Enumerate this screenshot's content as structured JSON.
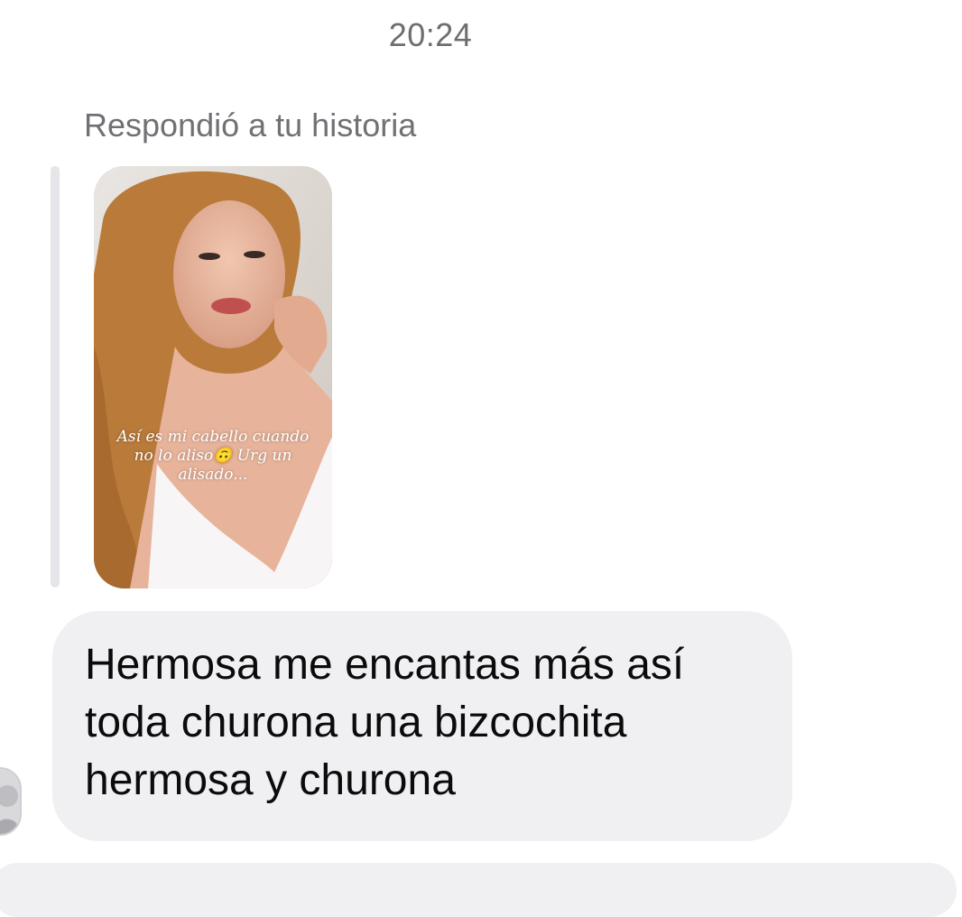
{
  "conversation": {
    "timestamp": "20:24",
    "reply_context": "Respondió a tu historia",
    "story": {
      "caption": "Así es mi cabello cuando no lo aliso🙃 Urg un alisado..."
    },
    "message": {
      "text": "Hermosa me encantas más así\ntoda churona una bizcochita\nhermosa y churona"
    }
  },
  "colors": {
    "bubble_bg": "#f0f0f2",
    "secondary_text": "#707075",
    "quote_bar": "#e6e6ea"
  }
}
